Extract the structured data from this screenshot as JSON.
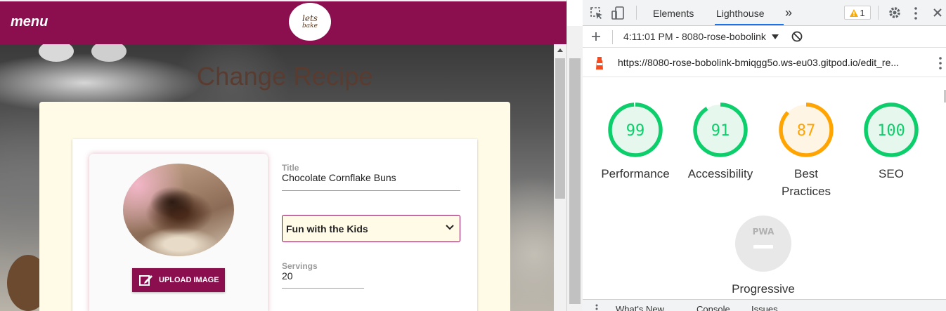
{
  "app": {
    "menu_label": "menu",
    "logo_text": "lets",
    "logo_sub": "bake",
    "page_title": "Change Recipe",
    "form": {
      "title_label": "Title",
      "title_value": "Chocolate Cornflake Buns",
      "category_selected": "Fun with the Kids",
      "servings_label": "Servings",
      "servings_value": "20",
      "upload_button": "UPLOAD IMAGE"
    }
  },
  "devtools": {
    "tabs": [
      "Elements",
      "Lighthouse"
    ],
    "active_tab": "Lighthouse",
    "more_tabs": "»",
    "warning_count": "1",
    "report_select": "4:11:01 PM - 8080-rose-bobolink",
    "audited_url": "https://8080-rose-bobolink-bmiqgg5o.ws-eu03.gitpod.io/edit_re...",
    "scores": [
      {
        "value": 99,
        "label": "Performance",
        "color": "#0cce6b",
        "fill": "#e6f8ee"
      },
      {
        "value": 91,
        "label": "Accessibility",
        "color": "#0cce6b",
        "fill": "#e6f8ee"
      },
      {
        "value": 87,
        "label": "Best Practices",
        "label_line1": "Best",
        "label_line2": "Practices",
        "color": "#ffa400",
        "fill": "#fff5e5"
      },
      {
        "value": 100,
        "label": "SEO",
        "color": "#0cce6b",
        "fill": "#e6f8ee"
      }
    ],
    "pwa": {
      "badge": "PWA",
      "label": "Progressive"
    },
    "drawer_tabs": [
      "What's New",
      "Console",
      "Issues"
    ]
  },
  "colors": {
    "brand": "#8b0f4f",
    "card_cream": "#fffbe6",
    "green": "#0cce6b",
    "orange": "#ffa400",
    "blue": "#1a73e8"
  }
}
